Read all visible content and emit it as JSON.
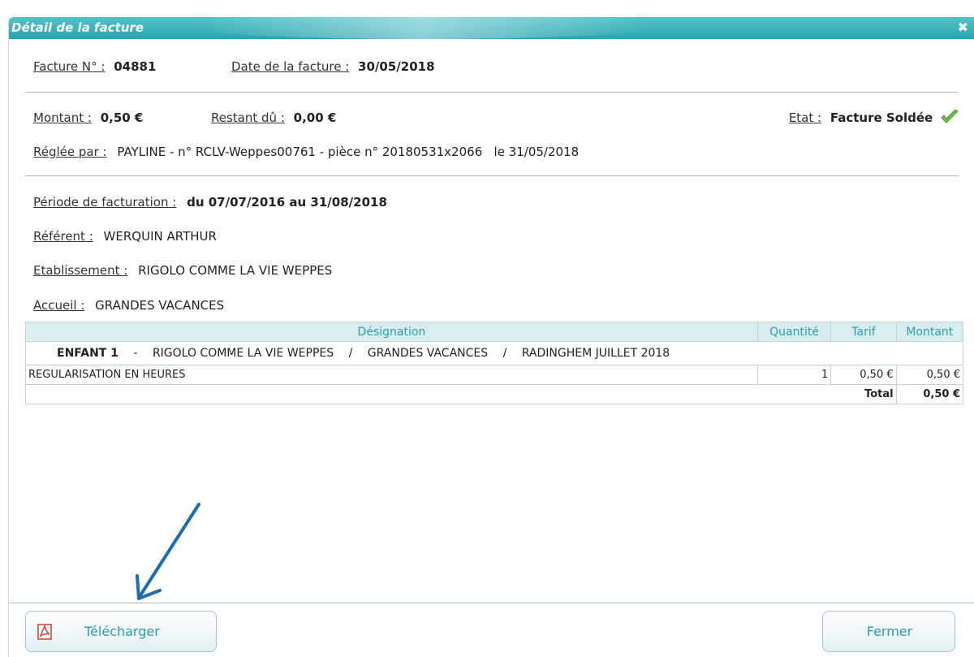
{
  "dialog": {
    "title": "Détail de la facture",
    "close_glyph": "✖"
  },
  "invoice": {
    "number_label": "Facture N° :",
    "number_value": "04881",
    "date_label": "Date de la facture :",
    "date_value": "30/05/2018",
    "amount_label": "Montant :",
    "amount_value": "0,50 €",
    "remaining_label": "Restant dû :",
    "remaining_value": "0,00 €",
    "state_label": "Etat :",
    "state_value": "Facture Soldée",
    "state_icon": "check-icon",
    "paid_by_label": "Réglée par :",
    "paid_by_value": "PAYLINE - n° RCLV-Weppes00761 - pièce n° 20180531x2066   le 31/05/2018",
    "period_label": "Période de facturation :",
    "period_value": "du 07/07/2016 au 31/08/2018",
    "referent_label": "Référent :",
    "referent_value": "WERQUIN ARTHUR",
    "establishment_label": "Etablissement :",
    "establishment_value": "RIGOLO COMME LA VIE WEPPES",
    "reception_label": "Accueil :",
    "reception_value": "GRANDES VACANCES"
  },
  "table": {
    "headers": [
      "Désignation",
      "Quantité",
      "Tarif",
      "Montant"
    ],
    "group": {
      "child": "ENFANT 1",
      "dash": "-",
      "establishment": "RIGOLO COMME LA VIE WEPPES",
      "slash": "/",
      "reception": "GRANDES VACANCES",
      "session": "RADINGHEM JUILLET 2018"
    },
    "rows": [
      {
        "designation": "REGULARISATION EN HEURES",
        "quantity": "1",
        "rate": "0,50 €",
        "amount": "0,50 €"
      }
    ],
    "total_label": "Total",
    "total_value": "0,50 €"
  },
  "buttons": {
    "download_label": "Télécharger",
    "download_icon": "pdf-icon",
    "close_label": "Fermer"
  },
  "colors": {
    "titlebar": "#2aa5ad",
    "accent": "#2a9ea6",
    "check": "#6cc04a",
    "arrow": "#1a6db5"
  }
}
